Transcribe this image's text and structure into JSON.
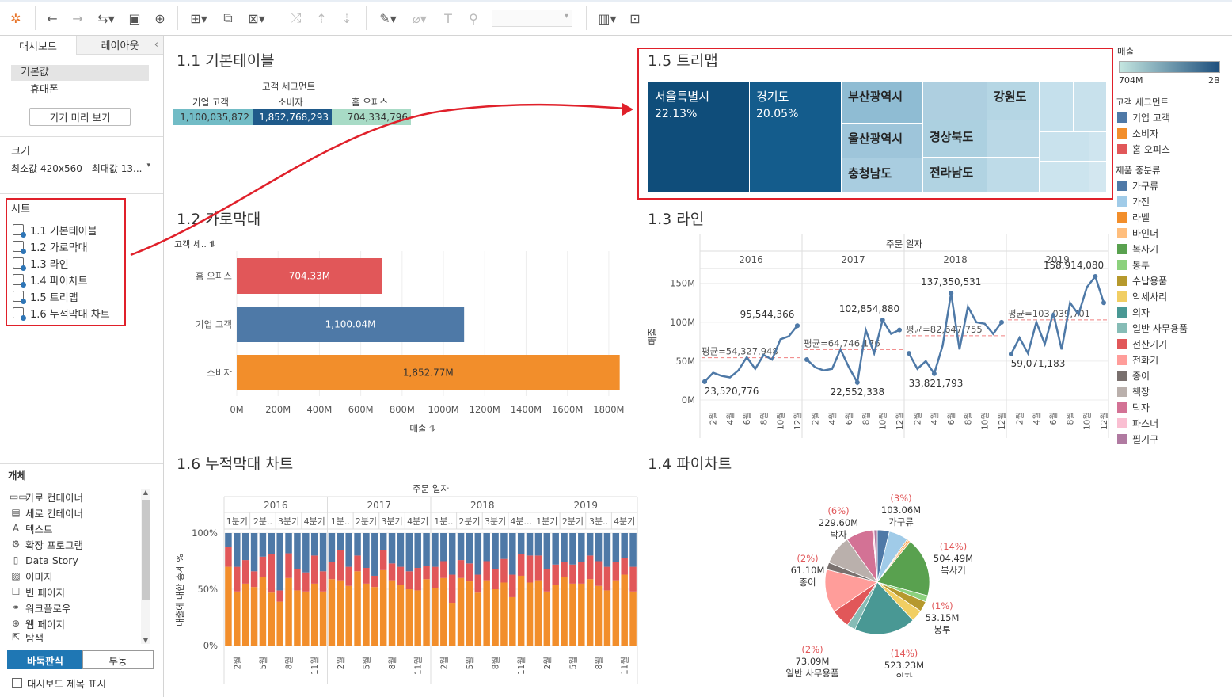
{
  "sidebar": {
    "tab_dashboard": "대시보드",
    "tab_layout": "레이아웃",
    "device_default": "기본값",
    "device_phone": "휴대폰",
    "device_preview_button": "기기 미리 보기",
    "size_title": "크기",
    "size_value": "최소값 420x560 - 최대값 13...",
    "sheets_title": "시트",
    "sheets": [
      "1.1 기본테이블",
      "1.2 가로막대",
      "1.3 라인",
      "1.4 파이차트",
      "1.5 트리맵",
      "1.6 누적막대 차트"
    ],
    "objects_title": "개체",
    "objects": [
      {
        "label": "가로 컨테이너",
        "icon": "horizontal-container-icon"
      },
      {
        "label": "세로 컨테이너",
        "icon": "vertical-container-icon"
      },
      {
        "label": "텍스트",
        "icon": "text-icon"
      },
      {
        "label": "확장 프로그램",
        "icon": "extension-icon"
      },
      {
        "label": "Data Story",
        "icon": "data-story-icon"
      },
      {
        "label": "이미지",
        "icon": "image-icon"
      },
      {
        "label": "빈 페이지",
        "icon": "blank-icon"
      },
      {
        "label": "워크플로우",
        "icon": "workflow-icon"
      },
      {
        "label": "웹 페이지",
        "icon": "web-page-icon"
      },
      {
        "label": "탐색",
        "icon": "navigation-icon"
      }
    ],
    "tiled_button": "바둑판식",
    "floating_button": "부동",
    "show_title_label": "대시보드 제목 표시"
  },
  "views": {
    "v11_title": "1.1 기본테이블",
    "v12_title": "1.2 가로막대",
    "v13_title": "1.3 라인",
    "v14_title": "1.4 파이차트",
    "v15_title": "1.5 트리맵",
    "v16_title": "1.6 누적막대 차트"
  },
  "table": {
    "group_header": "고객 세그먼트",
    "headers": [
      "기업 고객",
      "소비자",
      "홈 오피스"
    ],
    "values": [
      "1,100,035,872",
      "1,852,768,293",
      "704,334,796"
    ],
    "colors": [
      "#72bcc6",
      "#1f5a8a",
      "#a8dbc6"
    ]
  },
  "legend": {
    "sales_title": "매출",
    "sales_min": "704M",
    "sales_max": "2B",
    "segment_title": "고객 세그먼트",
    "segments": [
      {
        "label": "기업 고객",
        "color": "#4e79a7"
      },
      {
        "label": "소비자",
        "color": "#f28e2b"
      },
      {
        "label": "홈 오피스",
        "color": "#e15759"
      }
    ],
    "subcat_title": "제품 중분류",
    "subcats": [
      {
        "label": "가구류",
        "color": "#4e79a7"
      },
      {
        "label": "가전",
        "color": "#a0cbe8"
      },
      {
        "label": "라벨",
        "color": "#f28e2b"
      },
      {
        "label": "바인더",
        "color": "#ffbe7d"
      },
      {
        "label": "복사기",
        "color": "#59a14f"
      },
      {
        "label": "봉투",
        "color": "#8cd17d"
      },
      {
        "label": "수납용품",
        "color": "#b6992d"
      },
      {
        "label": "악세사리",
        "color": "#f1ce63"
      },
      {
        "label": "의자",
        "color": "#499894"
      },
      {
        "label": "일반 사무용품",
        "color": "#86bcb6"
      },
      {
        "label": "전산기기",
        "color": "#e15759"
      },
      {
        "label": "전화기",
        "color": "#ff9d9a"
      },
      {
        "label": "종이",
        "color": "#79706e"
      },
      {
        "label": "책장",
        "color": "#bab0ac"
      },
      {
        "label": "탁자",
        "color": "#d37295"
      },
      {
        "label": "파스너",
        "color": "#fabfd2"
      },
      {
        "label": "필기구",
        "color": "#b07aa1"
      }
    ]
  },
  "chart_data": [
    {
      "type": "bar",
      "id": "hbar",
      "ylabel": "고객 세..",
      "xlabel": "매출",
      "categories": [
        "홈 오피스",
        "기업 고객",
        "소비자"
      ],
      "values": [
        704.33,
        1100.04,
        1852.77
      ],
      "value_labels": [
        "704.33M",
        "1,100.04M",
        "1,852.77M"
      ],
      "colors": [
        "#e15759",
        "#4e79a7",
        "#f28e2b"
      ],
      "xlim": [
        0,
        1900
      ],
      "xticks": [
        "0M",
        "200M",
        "400M",
        "600M",
        "800M",
        "1000M",
        "1200M",
        "1400M",
        "1600M",
        "1800M"
      ]
    },
    {
      "type": "line",
      "id": "line",
      "header": "주문 일자",
      "ylabel": "매출",
      "years": [
        "2016",
        "2017",
        "2018",
        "2019"
      ],
      "ylim": [
        0,
        165000000
      ],
      "yticks": [
        "0M",
        "50M",
        "100M",
        "150M"
      ],
      "xticks": [
        "2월",
        "4월",
        "6월",
        "8월",
        "10월",
        "12월"
      ],
      "color": "#4e79a7",
      "series": [
        {
          "year": "2016",
          "values": [
            23520776,
            35000000,
            31000000,
            29000000,
            38000000,
            55000000,
            40000000,
            58000000,
            52000000,
            78000000,
            82000000,
            95544366
          ],
          "avg_label": "평균=54,327,948",
          "avg": 54327948,
          "max_label": "95,544,366",
          "min_label": "23,520,776"
        },
        {
          "year": "2017",
          "values": [
            52000000,
            42000000,
            38000000,
            40000000,
            65000000,
            42000000,
            22552338,
            90000000,
            60000000,
            102854880,
            85000000,
            90000000
          ],
          "avg_label": "평균=64,746,176",
          "avg": 64746176,
          "max_label": "102,854,880",
          "min_label": "22,552,338"
        },
        {
          "year": "2018",
          "values": [
            60000000,
            40000000,
            50000000,
            33821793,
            70000000,
            137350531,
            65000000,
            120000000,
            100000000,
            98000000,
            85000000,
            100000000
          ],
          "avg_label": "평균=82,647,755",
          "avg": 82647755,
          "max_label": "137,350,531",
          "min_label": "33,821,793"
        },
        {
          "year": "2019",
          "values": [
            59071183,
            80000000,
            60000000,
            100000000,
            72000000,
            112000000,
            65000000,
            125000000,
            110000000,
            145000000,
            158914080,
            125000000
          ],
          "avg_label": "평균=103,039,701",
          "avg": 103039701,
          "max_label": "158,914,080",
          "min_label": "59,071,183"
        }
      ]
    },
    {
      "type": "bar",
      "id": "stacked",
      "stacked": true,
      "header": "주문 일자",
      "ylabel": "매출에 대한 총계 %",
      "years": [
        "2016",
        "2017",
        "2018",
        "2019"
      ],
      "quarters": [
        "1분기",
        "2분..",
        "3분기",
        "4분기"
      ],
      "quarter_headers": [
        [
          "1분기",
          "2분..",
          "3분기",
          "4분기"
        ],
        [
          "1분..",
          "2분기",
          "3분기",
          "4분기"
        ],
        [
          "1분..",
          "2분기",
          "3분기",
          "4분..."
        ],
        [
          "1분기",
          "2분기",
          "3분..",
          "4분기"
        ]
      ],
      "yticks": [
        "100%",
        "50%",
        "0%"
      ],
      "xticks": [
        "2월",
        "5월",
        "8월",
        "11월"
      ],
      "series_names": [
        "소비자",
        "홈 오피스",
        "기업 고객"
      ],
      "colors": [
        "#f28e2b",
        "#e15759",
        "#4e79a7"
      ],
      "consumer": [
        0.7,
        0.48,
        0.55,
        0.52,
        0.61,
        0.47,
        0.39,
        0.6,
        0.49,
        0.48,
        0.55,
        0.48,
        0.59,
        0.58,
        0.53,
        0.66,
        0.55,
        0.52,
        0.67,
        0.58,
        0.54,
        0.5,
        0.49,
        0.59,
        0.51,
        0.6,
        0.38,
        0.6,
        0.57,
        0.47,
        0.58,
        0.5,
        0.56,
        0.43,
        0.62,
        0.56,
        0.58,
        0.48,
        0.54,
        0.61,
        0.55,
        0.55,
        0.59,
        0.53,
        0.49,
        0.58,
        0.63,
        0.48
      ],
      "homeoffice": [
        0.18,
        0.22,
        0.21,
        0.14,
        0.18,
        0.34,
        0.1,
        0.22,
        0.19,
        0.17,
        0.25,
        0.18,
        0.15,
        0.27,
        0.17,
        0.14,
        0.14,
        0.1,
        0.18,
        0.15,
        0.16,
        0.16,
        0.2,
        0.12,
        0.19,
        0.15,
        0.25,
        0.16,
        0.16,
        0.16,
        0.17,
        0.18,
        0.21,
        0.2,
        0.19,
        0.24,
        0.22,
        0.2,
        0.18,
        0.13,
        0.17,
        0.19,
        0.21,
        0.22,
        0.21,
        0.16,
        0.15,
        0.22
      ]
    },
    {
      "type": "pie",
      "id": "pie",
      "labels": [
        "가구류",
        "가전",
        "라벨",
        "바인더",
        "복사기",
        "봉투",
        "수납용품",
        "악세사리",
        "의자",
        "일반 사무용품",
        "전산기기",
        "전화기",
        "종이",
        "책장",
        "탁자",
        "파스너",
        "필기구"
      ],
      "values": [
        103.06,
        165,
        12,
        20,
        504.49,
        53.15,
        90,
        100,
        523.23,
        73.09,
        160,
        370,
        61.1,
        250,
        229.6,
        12,
        28
      ],
      "colors": [
        "#4e79a7",
        "#a0cbe8",
        "#f28e2b",
        "#ffbe7d",
        "#59a14f",
        "#8cd17d",
        "#b6992d",
        "#f1ce63",
        "#499894",
        "#86bcb6",
        "#e15759",
        "#ff9d9a",
        "#79706e",
        "#bab0ac",
        "#d37295",
        "#fabfd2",
        "#b07aa1"
      ],
      "annotations": [
        {
          "pct": "(3%)",
          "value": "103.06M",
          "name": "가구류"
        },
        {
          "pct": "(14%)",
          "value": "504.49M",
          "name": "복사기"
        },
        {
          "pct": "(1%)",
          "value": "53.15M",
          "name": "봉투"
        },
        {
          "pct": "(14%)",
          "value": "523.23M",
          "name": "의자"
        },
        {
          "pct": "(2%)",
          "value": "73.09M",
          "name": "일반 사무용품"
        },
        {
          "pct": "(2%)",
          "value": "61.10M",
          "name": "종이"
        },
        {
          "pct": "(6%)",
          "value": "229.60M",
          "name": "탁자"
        }
      ]
    },
    {
      "type": "treemap",
      "id": "treemap",
      "cells": [
        {
          "name": "서울특별시",
          "pct": "22.13%",
          "color": "#0f4d7a"
        },
        {
          "name": "경기도",
          "pct": "20.05%",
          "color": "#145c8c"
        },
        {
          "name": "부산광역시",
          "color": "#8fbcd3"
        },
        {
          "name": "울산광역시",
          "color": "#9ec5da"
        },
        {
          "name": "충청남도",
          "color": "#a9cde0"
        },
        {
          "name": "경상북도",
          "color": "#acd0e0"
        },
        {
          "name": "전라남도",
          "color": "#b1d3e2"
        },
        {
          "name": "강원도",
          "color": "#b5d6e4"
        }
      ]
    }
  ]
}
